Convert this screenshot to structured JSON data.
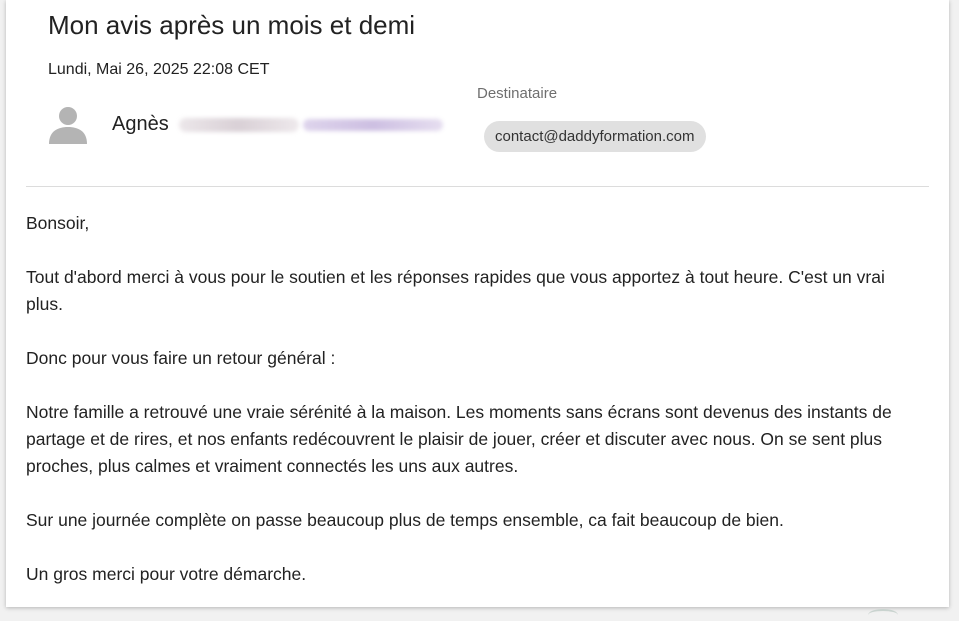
{
  "email": {
    "subject": "Mon avis après un mois et demi",
    "date": "Lundi, Mai 26, 2025 22:08 CET",
    "sender": {
      "name": "Agnès",
      "avatar_icon": "person-icon"
    },
    "recipient": {
      "label": "Destinataire",
      "address": "contact@daddyformation.com"
    },
    "body": {
      "greeting": "Bonsoir,",
      "paragraph_1": "Tout d'abord merci à vous pour le soutien et les réponses rapides que vous apportez à tout heure. C'est un vrai plus.",
      "paragraph_2": "Donc pour vous faire un retour général :",
      "paragraph_3": "Notre famille a retrouvé une vraie sérénité à la maison. Les moments sans écrans sont devenus des instants de partage et de rires, et nos enfants redécouvrent le plaisir de jouer, créer et discuter avec nous. On se sent plus proches, plus calmes et vraiment connectés les uns aux autres.",
      "paragraph_4": "Sur une journée complète on passe beaucoup plus de temps ensemble, ca fait beaucoup de bien.",
      "closing": "Un gros merci pour votre démarche."
    }
  },
  "colors": {
    "background": "#f1f1f1",
    "card": "#ffffff",
    "text": "#222222",
    "muted": "#6f6f6f",
    "chip": "#e0e0e0",
    "avatar": "#b4b4b4"
  }
}
